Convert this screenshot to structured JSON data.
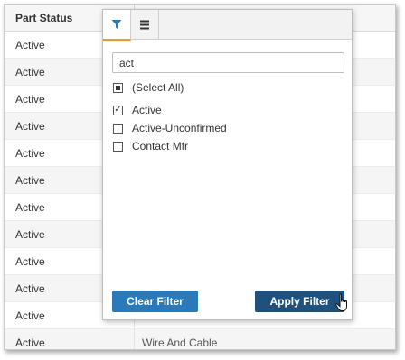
{
  "grid": {
    "column_header": "Part Status",
    "rows": [
      {
        "status": "Active",
        "other": ""
      },
      {
        "status": "Active",
        "other": ""
      },
      {
        "status": "Active",
        "other": ""
      },
      {
        "status": "Active",
        "other": ""
      },
      {
        "status": "Active",
        "other": ""
      },
      {
        "status": "Active",
        "other": ""
      },
      {
        "status": "Active",
        "other": ""
      },
      {
        "status": "Active",
        "other": ""
      },
      {
        "status": "Active",
        "other": ""
      },
      {
        "status": "Active",
        "other": ""
      },
      {
        "status": "Active",
        "other": "Wire And Cable"
      },
      {
        "status": "Active",
        "other": "Wire And Cable"
      }
    ]
  },
  "filter_popup": {
    "tabs": [
      {
        "name": "filter-tab",
        "icon": "filter-icon",
        "active": true
      },
      {
        "name": "columns-tab",
        "icon": "menu-icon",
        "active": false
      }
    ],
    "search_value": "act",
    "select_all": {
      "label": "(Select All)",
      "state": "indeterminate"
    },
    "options": [
      {
        "label": "Active",
        "checked": true
      },
      {
        "label": "Active-Unconfirmed",
        "checked": false
      },
      {
        "label": "Contact Mfr",
        "checked": false
      }
    ],
    "clear_label": "Clear Filter",
    "apply_label": "Apply Filter"
  },
  "colors": {
    "accent_tab": "#f39c12",
    "filter_icon": "#2a79b9",
    "clear_button": "#2a79b9",
    "apply_button": "#1e527c"
  }
}
